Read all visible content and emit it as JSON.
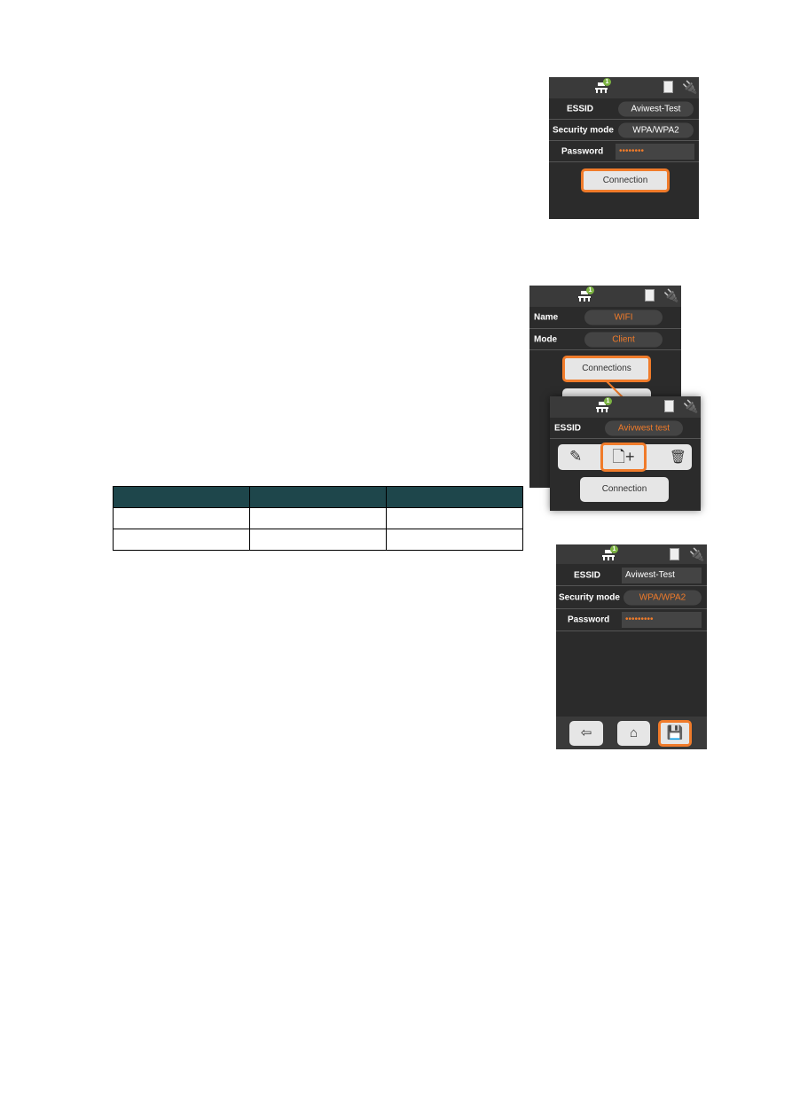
{
  "panel1": {
    "badge": "1",
    "essid_label": "ESSID",
    "essid_value": "Aviwest-Test",
    "security_label": "Security mode",
    "security_value": "WPA/WPA2",
    "password_label": "Password",
    "password_value": "••••••••",
    "connection_button": "Connection"
  },
  "panel2": {
    "badge": "1",
    "name_label": "Name",
    "name_value": "WIFI",
    "mode_label": "Mode",
    "mode_value": "Client",
    "connections_button": "Connections"
  },
  "panel2_popup": {
    "badge": "1",
    "essid_label": "ESSID",
    "essid_value": "Avivwest test",
    "connection_button": "Connection",
    "icons": [
      "edit-icon",
      "add-file-icon",
      "trash-icon"
    ]
  },
  "panel3": {
    "badge": "1",
    "essid_label": "ESSID",
    "essid_value": "Aviwest-Test",
    "security_label": "Security mode",
    "security_value": "WPA/WPA2",
    "password_label": "Password",
    "password_value": "•••••••••",
    "footer_icons": [
      "back-icon",
      "home-icon",
      "save-icon"
    ]
  },
  "colors": {
    "accent": "#f07b2a",
    "panel": "#2b2b2b",
    "table_header": "#1e464b"
  }
}
